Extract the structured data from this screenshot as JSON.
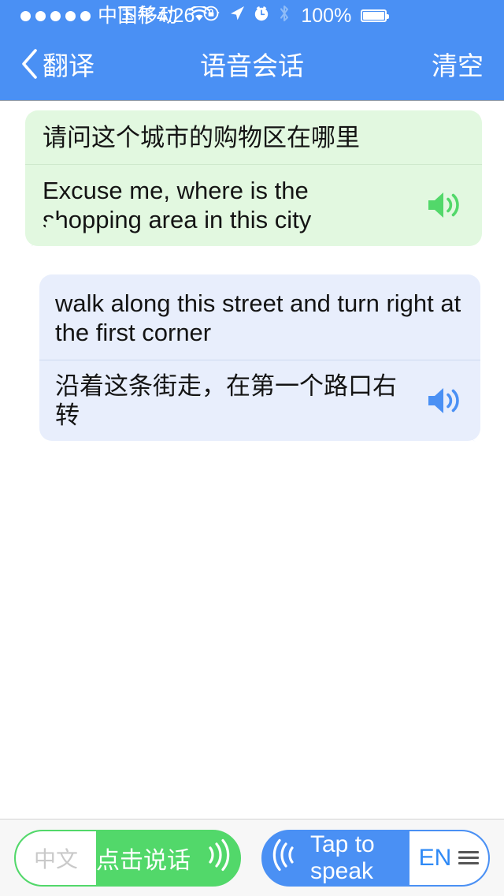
{
  "status_bar": {
    "signal_dots": 5,
    "signal_dots_filled": 5,
    "carrier": "中国移动",
    "wifi_icon": "wifi-icon",
    "time": "下午4:26",
    "icons": [
      "rotation-lock-icon",
      "location-arrow-icon",
      "alarm-clock-icon",
      "bluetooth-icon"
    ],
    "battery_percent": "100%",
    "battery_icon": "battery-full-icon",
    "background_color": "#4a90f4",
    "text_color": "#ffffff"
  },
  "nav_bar": {
    "back_icon": "chevron-left-icon",
    "back_label": "翻译",
    "title": "语音会话",
    "right_action_label": "清空",
    "background_color": "#4a90f4"
  },
  "conversation": {
    "messages": [
      {
        "side": "left",
        "bubble_color": "#e2f8e0",
        "speaker_icon_color": "#52d86a",
        "speaker_icon": "speaker-wave-icon",
        "primary_text": "请问这个城市的购物区在哪里",
        "primary_lang": "zh",
        "secondary_text": "Excuse me, where is the shopping area in this city",
        "secondary_lang": "en"
      },
      {
        "side": "right",
        "bubble_color": "#e8eefc",
        "speaker_icon_color": "#4a90f4",
        "speaker_icon": "speaker-wave-icon",
        "primary_text": "walk along this street and turn right at the first corner",
        "primary_lang": "en",
        "secondary_text": "沿着这条街走，在第一个路口右转",
        "secondary_lang": "zh"
      }
    ]
  },
  "toolbar": {
    "zh_button": {
      "lang_label": "中文",
      "action_label": "点击说话",
      "waves_icon": "sound-waves-right-icon",
      "color": "#52d86a"
    },
    "en_button": {
      "waves_icon": "sound-waves-left-icon",
      "action_label": "Tap to speak",
      "lang_label": "EN",
      "menu_icon": "hamburger-menu-icon",
      "color": "#4a90f4"
    },
    "background_color": "#f7f7f7"
  }
}
